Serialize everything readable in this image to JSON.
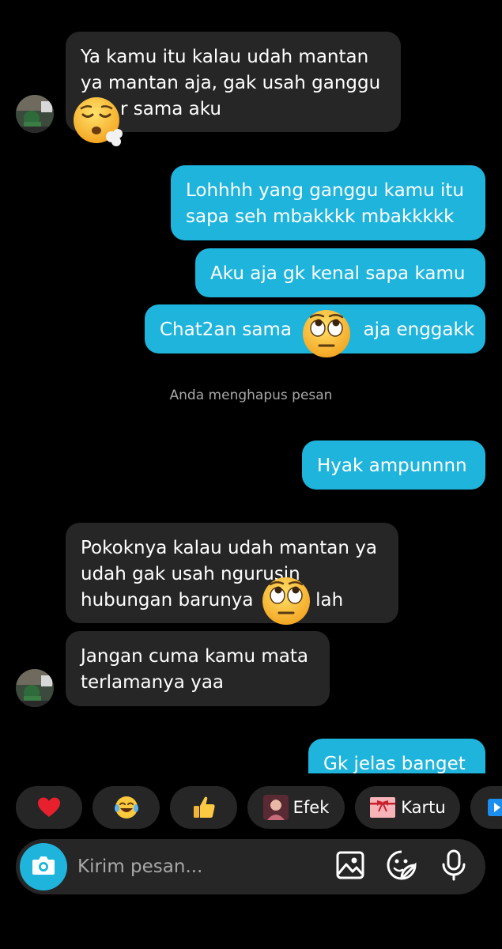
{
  "messages": {
    "m1": {
      "lines": [
        "Ya kamu itu kalau udah mantan",
        "ya mantan aja, gak usah ganggu",
        "r sama aku"
      ]
    },
    "m2": {
      "lines": [
        "Lohhhh yang ganggu kamu itu",
        "sapa seh mbakkkk mbakkkkk"
      ]
    },
    "m3": {
      "lines": [
        "Aku aja gk kenal sapa kamu"
      ]
    },
    "m4": {
      "part1": "Chat2an sama",
      "part2": "aja enggakk"
    },
    "m5": {
      "lines": [
        "Hyak ampunnnn"
      ]
    },
    "m6": {
      "lines": [
        "Pokoknya kalau udah mantan ya",
        "udah gak usah ngurusin"
      ],
      "line3_part1": "hubungan barunya",
      "line3_part2": "lah"
    },
    "m7": {
      "lines": [
        "Jangan cuma kamu mata",
        "terlamanya yaa"
      ]
    },
    "m8": {
      "lines": [
        "Gk jelas banget"
      ]
    }
  },
  "system_note": "Anda menghapus pesan",
  "emoji_overlays": [
    "sleepy-face-emoji",
    "eye-roll-emoji",
    "eye-roll-emoji"
  ],
  "quick_reactions": [
    {
      "icon": "heart-icon",
      "label": ""
    },
    {
      "icon": "laughing-tears-icon",
      "label": ""
    },
    {
      "icon": "thumbs-up-icon",
      "label": ""
    },
    {
      "icon": "profile-photo",
      "label": "Efek"
    },
    {
      "icon": "gift-card-icon",
      "label": "Kartu"
    }
  ],
  "composer": {
    "placeholder": "Kirim pesan...",
    "icons": [
      "camera-icon",
      "image-icon",
      "sticker-icon",
      "microphone-icon"
    ]
  },
  "colors": {
    "background": "#000000",
    "incoming_bubble": "#262626",
    "outgoing_bubble": "#1fb4dc",
    "accent": "#1fb4dc",
    "muted_text": "#a8a8a8"
  }
}
